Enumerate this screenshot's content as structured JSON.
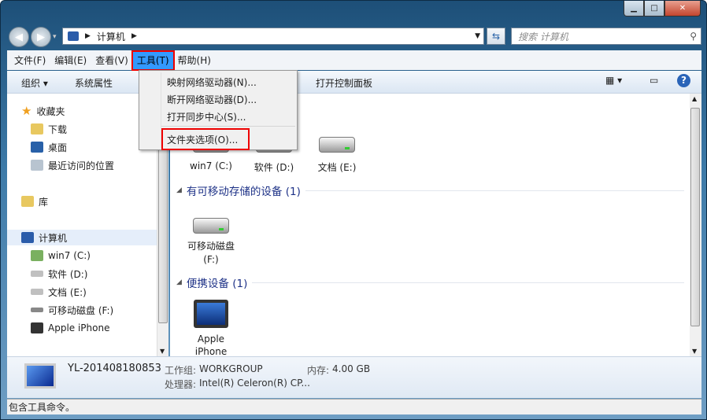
{
  "address": {
    "path": [
      "计算机"
    ]
  },
  "search": {
    "placeholder": "搜索 计算机"
  },
  "menubar": [
    {
      "label": "文件(F)"
    },
    {
      "label": "编辑(E)"
    },
    {
      "label": "查看(V)"
    },
    {
      "label": "工具(T)",
      "active": true
    },
    {
      "label": "帮助(H)"
    }
  ],
  "toolbar": {
    "organize": "组织 ▾",
    "system_properties": "系统属性",
    "control_panel": "打开控制面板"
  },
  "tools_menu": [
    {
      "label": "映射网络驱动器(N)..."
    },
    {
      "label": "断开网络驱动器(D)..."
    },
    {
      "label": "打开同步中心(S)..."
    },
    {
      "label": "文件夹选项(O)...",
      "highlighted": true
    }
  ],
  "sidebar": {
    "favorites": "收藏夹",
    "items": [
      "下载",
      "桌面",
      "最近访问的位置"
    ],
    "library": "库",
    "computer": "计算机",
    "drives": [
      "win7 (C:)",
      "软件 (D:)",
      "文档 (E:)",
      "可移动磁盘 (F:)",
      "Apple iPhone"
    ]
  },
  "content": {
    "hard_drives": [
      "win7 (C:)",
      "软件 (D:)",
      "文档 (E:)"
    ],
    "removable_header": "有可移动存储的设备 (1)",
    "removable": [
      "可移动磁盘",
      "(F:)"
    ],
    "portable_header": "便携设备 (1)",
    "portable": [
      "Apple",
      "iPhone"
    ]
  },
  "details": {
    "name": "YL-201408180853",
    "workgroup_label": "工作组:",
    "workgroup": "WORKGROUP",
    "memory_label": "内存:",
    "memory": "4.00 GB",
    "cpu_label": "处理器:",
    "cpu": "Intel(R) Celeron(R) CP..."
  },
  "status": "包含工具命令。",
  "colors": {
    "menu_active": "#3399ff",
    "highlight_box": "#ee0000",
    "group_header": "#1e3287"
  }
}
